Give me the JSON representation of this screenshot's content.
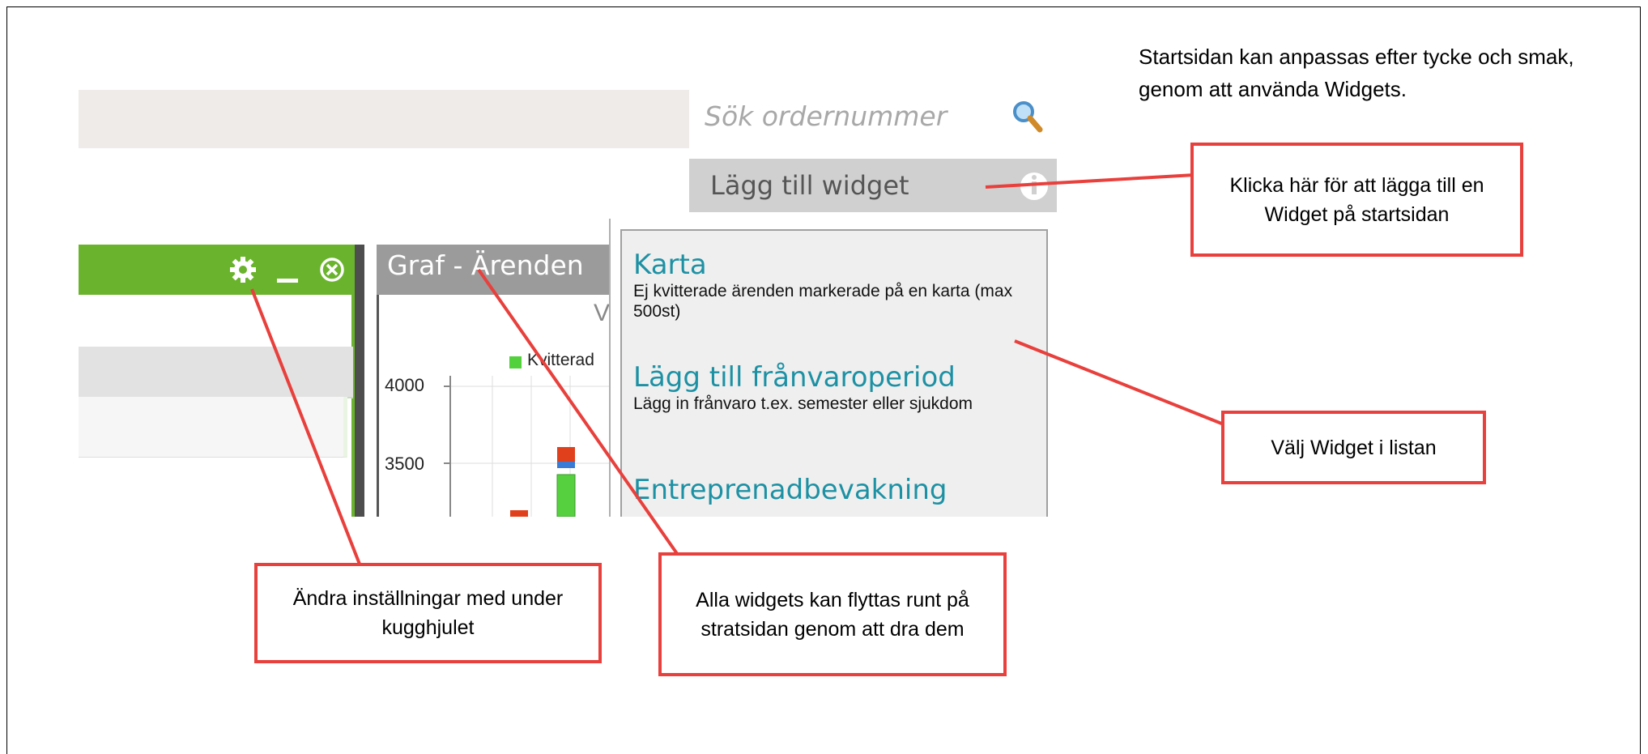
{
  "search": {
    "placeholder": "Sök ordernummer"
  },
  "toolbar": {
    "add_widget_label": "Lägg till widget"
  },
  "graph_widget": {
    "title": "Graf - Ärenden",
    "title_peek": "V",
    "legend_label": "Kvitterad",
    "y_ticks": [
      "4000",
      "3500"
    ]
  },
  "widget_menu": {
    "items": [
      {
        "title": "Karta",
        "description": "Ej kvitterade ärenden markerade på en karta (max 500st)"
      },
      {
        "title": "Lägg till frånvaroperiod",
        "description": "Lägg in frånvaro t.ex. semester eller sjukdom"
      },
      {
        "title": "Entreprenadbevakning",
        "description": ""
      }
    ]
  },
  "annotations": {
    "intro": "Startsidan kan anpassas efter tycke och smak, genom att använda Widgets.",
    "add_widget_hint": "Klicka här för att lägga till en Widget på startsidan",
    "choose_widget_hint": "Välj Widget i listan",
    "settings_hint": "Ändra inställningar med under kugghjulet",
    "move_hint": "Alla widgets kan flyttas runt på stratsidan genom att dra dem"
  },
  "colors": {
    "accent_green": "#6ab42d",
    "callout_red": "#e8403c",
    "menu_title": "#1d91a4",
    "graph_header": "#9b9b9b"
  },
  "icons": [
    "search-icon",
    "info-icon",
    "gear-icon",
    "minimize-icon",
    "close-icon"
  ]
}
